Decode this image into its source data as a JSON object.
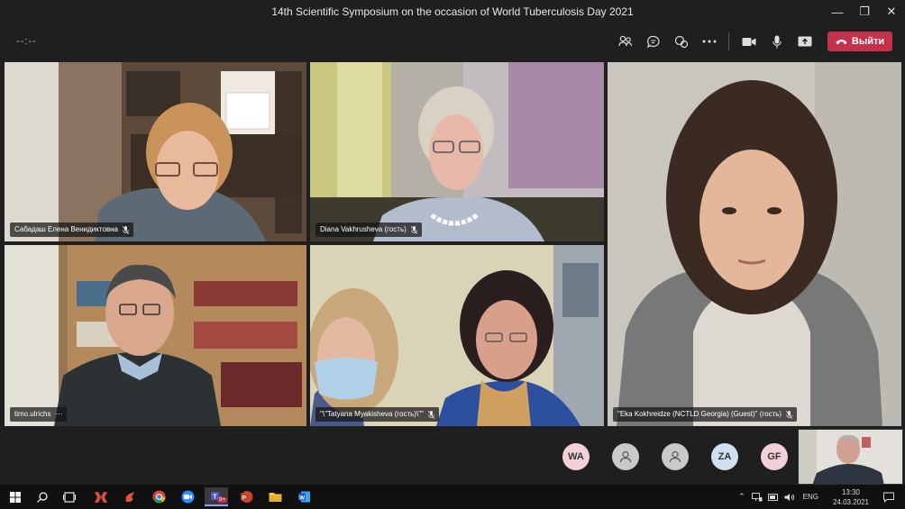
{
  "window": {
    "title": "14th Scientific Symposium on the occasion of World Tuberculosis Day 2021"
  },
  "toolbar": {
    "timer": "--:--",
    "leave_label": "Выйти"
  },
  "participants": [
    {
      "name": "Сабадаш Елена Венидиктовна",
      "muted": true
    },
    {
      "name": "Diana Vakhrusheva (гость)",
      "muted": true
    },
    {
      "name": "\"Eka Kokhreidze (NCTLD Georgia) (Guest)\" (гость)",
      "muted": true
    },
    {
      "name": "timo.ulrichs",
      "more": "···"
    },
    {
      "name": "\"\\\"Tatyana Myakisheva (гость)\\\"\"",
      "muted": true
    }
  ],
  "overflow_avatars": [
    {
      "initials": "WA",
      "color": "#f2d0d8"
    },
    {
      "initials": "",
      "color": "#c9c9c9"
    },
    {
      "initials": "",
      "color": "#c9c9c9"
    },
    {
      "initials": "ZA",
      "color": "#cfe0f2"
    },
    {
      "initials": "GF",
      "color": "#f2d0d8"
    }
  ],
  "taskbar": {
    "teams_badge": "9+",
    "language": "ENG",
    "time": "13:30",
    "date": "24.03.2021"
  },
  "colors": {
    "leave_button": "#c4314b",
    "background": "#1f1f1f"
  }
}
